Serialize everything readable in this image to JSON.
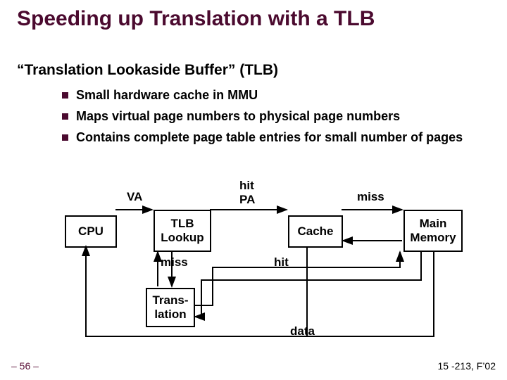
{
  "title": "Speeding up Translation with a TLB",
  "subtitle": "“Translation Lookaside Buffer” (TLB)",
  "bullets": [
    "Small hardware cache in MMU",
    "Maps virtual page numbers to  physical page numbers",
    "Contains complete page table entries for small number of pages"
  ],
  "diagram": {
    "cpu": "CPU",
    "tlb": "TLB\nLookup",
    "cache": "Cache",
    "mem": "Main\nMemory",
    "trans": "Trans-\nlation",
    "va": "VA",
    "pa_hit": "hit\nPA",
    "miss_top": "miss",
    "miss_bot": "miss",
    "hit_bot": "hit",
    "data": "data"
  },
  "footer": {
    "left": "– 56 –",
    "right": "15 -213, F’02"
  }
}
